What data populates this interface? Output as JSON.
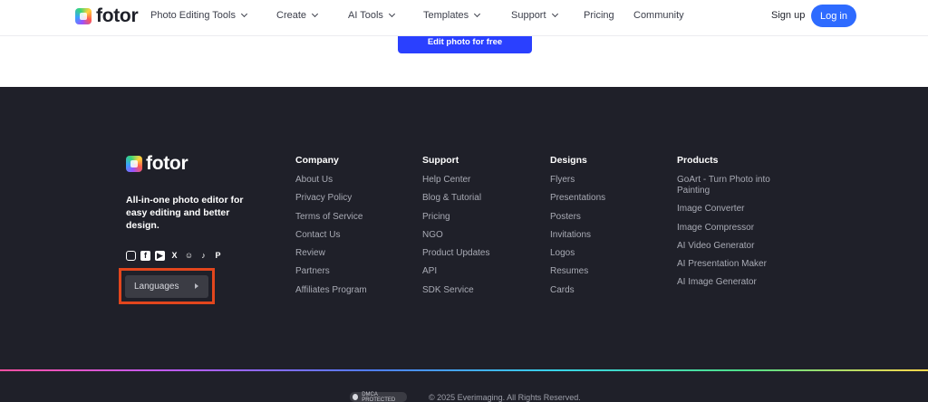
{
  "header": {
    "logo_text": "fotor",
    "nav": [
      {
        "label": "Photo Editing Tools",
        "dropdown": true
      },
      {
        "label": "Create",
        "dropdown": true
      },
      {
        "label": "AI Tools",
        "dropdown": true
      },
      {
        "label": "Templates",
        "dropdown": true
      },
      {
        "label": "Support",
        "dropdown": true
      },
      {
        "label": "Pricing",
        "dropdown": false
      },
      {
        "label": "Community",
        "dropdown": false
      }
    ],
    "signup_label": "Sign up",
    "login_label": "Log in"
  },
  "cta": {
    "label": "Edit photo for free"
  },
  "footer": {
    "logo_text": "fotor",
    "tagline": "All-in-one photo editor for easy editing and better design.",
    "socials": [
      "instagram-icon",
      "facebook-icon",
      "youtube-icon",
      "x-icon",
      "discord-icon",
      "tiktok-icon",
      "pinterest-icon"
    ],
    "language_button": "Languages",
    "columns": [
      {
        "title": "Company",
        "links": [
          "About Us",
          "Privacy Policy",
          "Terms of Service",
          "Contact Us",
          "Review",
          "Partners",
          "Affiliates Program"
        ]
      },
      {
        "title": "Support",
        "links": [
          "Help Center",
          "Blog & Tutorial",
          "Pricing",
          "NGO",
          "Product Updates",
          "API",
          "SDK Service"
        ]
      },
      {
        "title": "Designs",
        "links": [
          "Flyers",
          "Presentations",
          "Posters",
          "Invitations",
          "Logos",
          "Resumes",
          "Cards"
        ]
      },
      {
        "title": "Products",
        "links": [
          "GoArt - Turn Photo into Painting",
          "Image Converter",
          "Image Compressor",
          "AI Video Generator",
          "AI Presentation Maker",
          "AI Image Generator"
        ]
      }
    ],
    "dmca_label": "DMCA PROTECTED",
    "copyright": "© 2025 Everimaging. All Rights Reserved."
  },
  "colors": {
    "footer_bg": "#1f2029",
    "login_button": "#2e6bff",
    "cta_button": "#2a40ff",
    "highlight_box": "#e2461d"
  }
}
